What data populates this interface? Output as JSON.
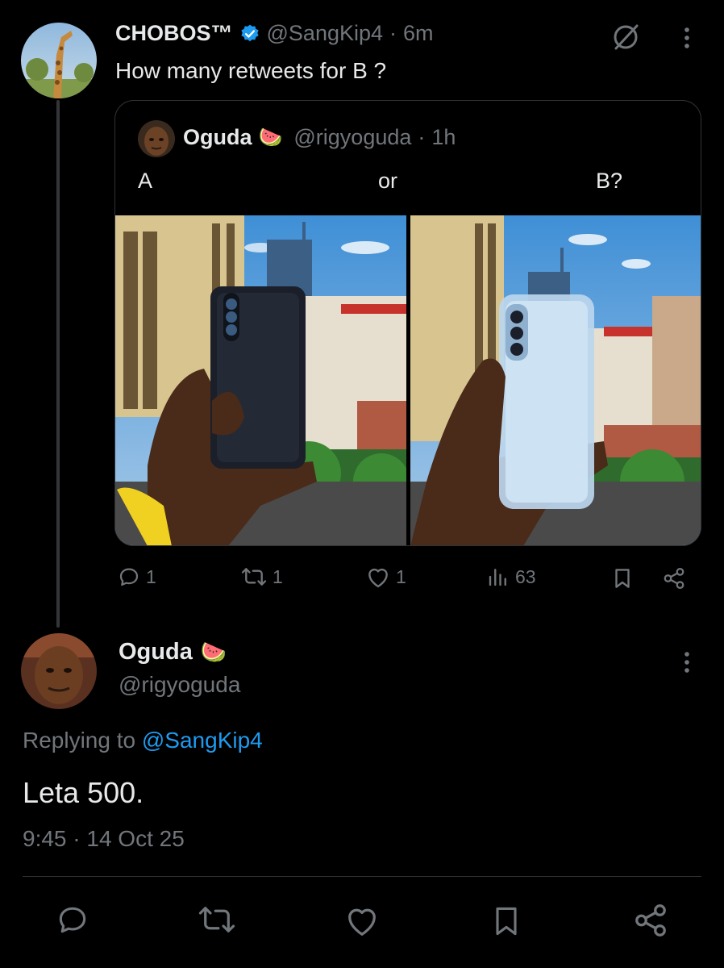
{
  "tweet": {
    "author_name": "CHOBOS™",
    "handle": "@SangKip4",
    "separator": "·",
    "time": "6m",
    "text": "How many retweets for B ?",
    "quote": {
      "author_name": "Oguda",
      "emoji": "🍉",
      "handle": "@rigyoguda",
      "separator": "·",
      "time": "1h",
      "label_a": "A",
      "label_or": "or",
      "label_b": "B?"
    },
    "actions": {
      "replies": "1",
      "retweets": "1",
      "likes": "1",
      "views": "63"
    }
  },
  "reply": {
    "author_name": "Oguda",
    "emoji": "🍉",
    "handle": "@rigyoguda",
    "replying_prefix": "Replying to",
    "replying_handle": "@SangKip4",
    "text": "Leta 500.",
    "timestamp": "9:45 · 14 Oct 25"
  },
  "colors": {
    "background": "#000000",
    "text": "#e7e9ea",
    "muted": "#71767b",
    "link": "#1d9bf0",
    "verified": "#1d9bf0"
  },
  "icons": [
    "verified-badge-icon",
    "grok-icon",
    "more-icon",
    "reply-icon",
    "retweet-icon",
    "like-icon",
    "views-icon",
    "bookmark-icon",
    "share-icon"
  ]
}
